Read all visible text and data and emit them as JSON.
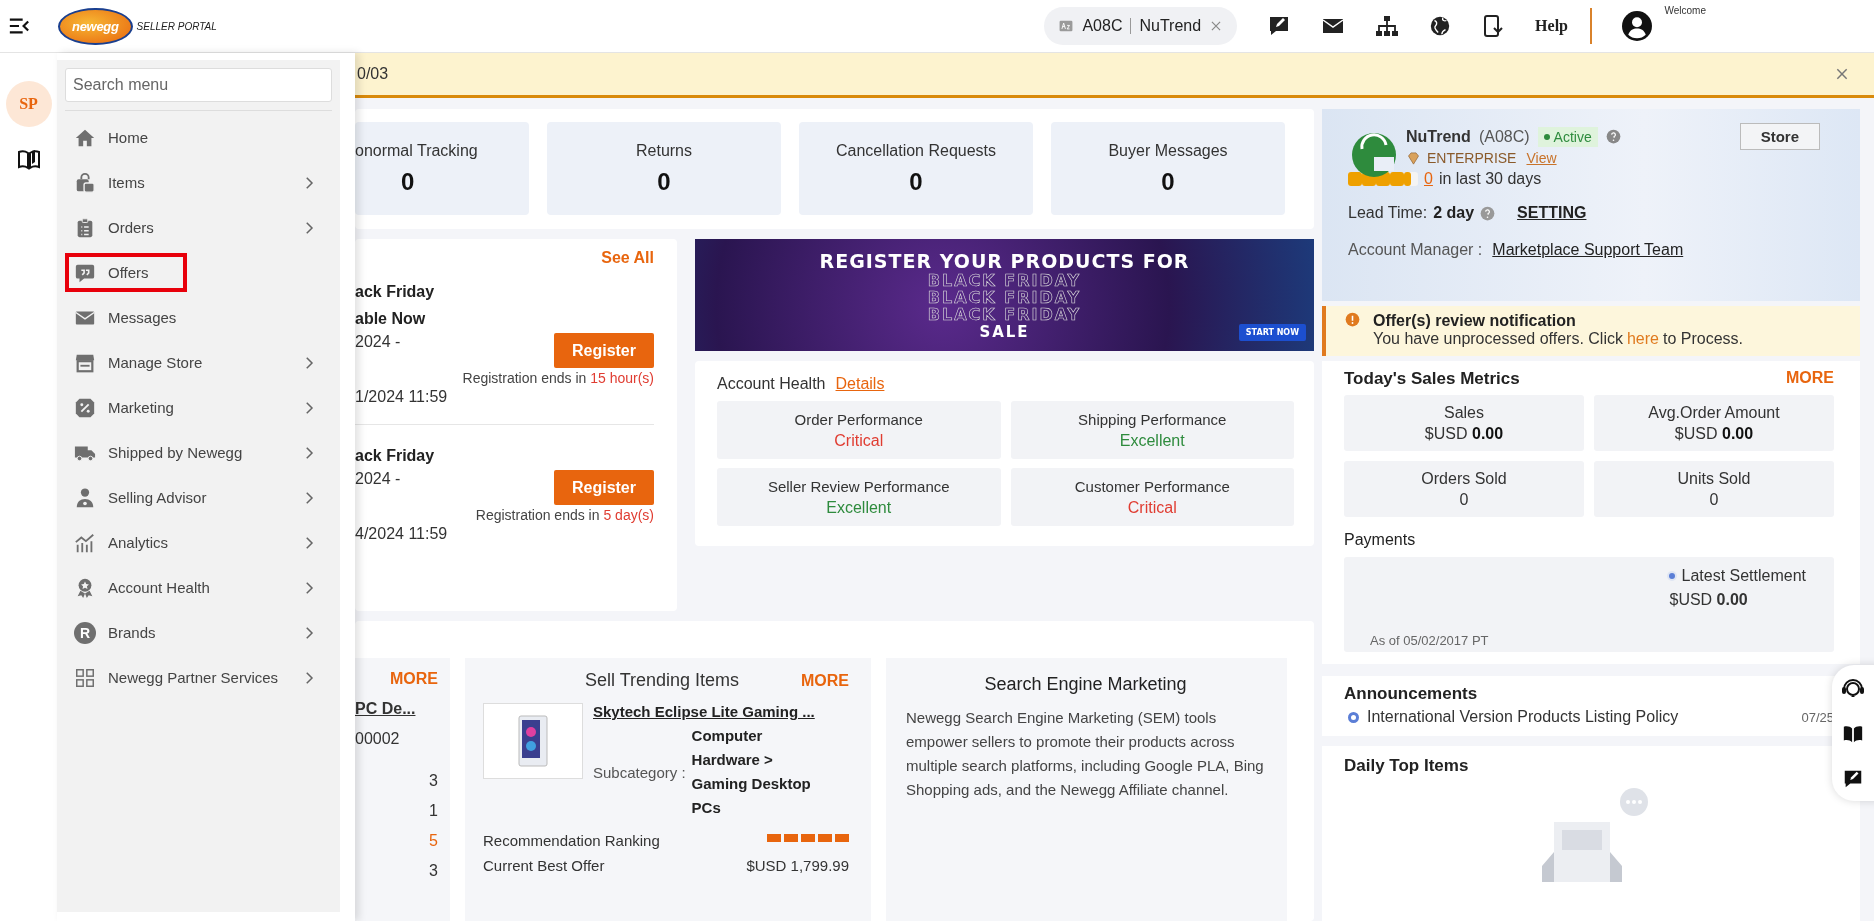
{
  "top_bar": {
    "logo_text": "newegg",
    "portal_label": "SELLER PORTAL",
    "seller_chip": {
      "code": "A08C",
      "name": "NuTrend"
    },
    "help": "Help",
    "welcome": "Welcome"
  },
  "rail": {
    "badge": "SP"
  },
  "menu": {
    "search_placeholder": "Search menu",
    "items": [
      {
        "label": "Home",
        "has_submenu": false,
        "highlighted": false
      },
      {
        "label": "Items",
        "has_submenu": true,
        "highlighted": false
      },
      {
        "label": "Orders",
        "has_submenu": true,
        "highlighted": false
      },
      {
        "label": "Offers",
        "has_submenu": false,
        "highlighted": true
      },
      {
        "label": "Messages",
        "has_submenu": false,
        "highlighted": false
      },
      {
        "label": "Manage Store",
        "has_submenu": true,
        "highlighted": false
      },
      {
        "label": "Marketing",
        "has_submenu": true,
        "highlighted": false
      },
      {
        "label": "Shipped by Newegg",
        "has_submenu": true,
        "highlighted": false
      },
      {
        "label": "Selling Advisor",
        "has_submenu": true,
        "highlighted": false
      },
      {
        "label": "Analytics",
        "has_submenu": true,
        "highlighted": false
      },
      {
        "label": "Account Health",
        "has_submenu": true,
        "highlighted": false
      },
      {
        "label": "Brands",
        "icon_text": "R",
        "has_submenu": true,
        "highlighted": false
      },
      {
        "label": "Newegg Partner Services",
        "has_submenu": true,
        "highlighted": false
      }
    ]
  },
  "notice_bar": {
    "text": "0/03"
  },
  "summary_cards": [
    {
      "label": "onormal Tracking",
      "value": "0"
    },
    {
      "label": "Returns",
      "value": "0"
    },
    {
      "label": "Cancellation Requests",
      "value": "0"
    },
    {
      "label": "Buyer Messages",
      "value": "0"
    }
  ],
  "events": {
    "see_all": "See All",
    "entries": [
      {
        "title_lines": [
          "ack Friday",
          "able Now"
        ],
        "start": "2024 -",
        "end": "1/2024 11:59",
        "button": "Register",
        "ends_prefix": "Registration ends in",
        "ends_value": "15 hour(s)"
      },
      {
        "title_lines": [
          "ack Friday"
        ],
        "start": "2024 -",
        "end": "4/2024 11:59",
        "button": "Register",
        "ends_prefix": "Registration ends in",
        "ends_value": "5 day(s)"
      }
    ]
  },
  "promo_banner": {
    "headline": "REGISTER YOUR PRODUCTS FOR",
    "repeat_lines": [
      "BLACK FRIDAY",
      "BLACK FRIDAY",
      "BLACK FRIDAY"
    ],
    "sale": "SALE",
    "cta": "START NOW"
  },
  "account_health": {
    "title": "Account Health",
    "details_link": "Details",
    "tiles": [
      {
        "label": "Order Performance",
        "status": "Critical",
        "color": "#e03c31"
      },
      {
        "label": "Shipping Performance",
        "status": "Excellent",
        "color": "#2e8b3d"
      },
      {
        "label": "Seller Review Performance",
        "status": "Excellent",
        "color": "#2e8b3d"
      },
      {
        "label": "Customer Performance",
        "status": "Critical",
        "color": "#e03c31"
      }
    ]
  },
  "top_sellers": {
    "more": "MORE",
    "item_name": "PC De...",
    "item_number": "00002",
    "counts": [
      {
        "value": "3",
        "color": "#333333"
      },
      {
        "value": "1",
        "color": "#333333"
      },
      {
        "value": "5",
        "color": "#e8650e"
      },
      {
        "value": "3",
        "color": "#333333"
      }
    ]
  },
  "sell_trending": {
    "title": "Sell Trending Items",
    "more": "MORE",
    "product_name": "Skytech Eclipse Lite Gaming ...",
    "subcategory_label": "Subcategory :",
    "subcategory": "Computer Hardware > Gaming Desktop PCs",
    "ranking_label": "Recommendation Ranking",
    "stars": 5,
    "offer_label": "Current Best Offer",
    "offer_value": "$USD 1,799.99"
  },
  "sem": {
    "title": "Search Engine Marketing",
    "text": "Newegg Search Engine Marketing (SEM) tools empower sellers to promote their products across multiple search platforms, including Google PLA, Bing Shopping ads, and the Newegg Affiliate channel."
  },
  "store": {
    "name": "NuTrend",
    "code": "(A08C)",
    "status": "Active",
    "store_button": "Store",
    "tier": "ENTERPRISE",
    "view_link": "View",
    "stars": 4.5,
    "review_count": "0",
    "review_period": "in last 30 days",
    "lead_label": "Lead Time:",
    "lead_value": "2 day",
    "setting_link": "SETTING",
    "manager_label": "Account Manager :",
    "manager_link": "Marketplace Support Team"
  },
  "offer_notification": {
    "title": "Offer(s) review notification",
    "text_before": "You have unprocessed offers. Click",
    "link": "here",
    "text_after": "to Process."
  },
  "sales_metrics": {
    "title": "Today's Sales Metrics",
    "more": "MORE",
    "tiles": [
      {
        "label": "Sales",
        "prefix": "$USD",
        "value": "0.00"
      },
      {
        "label": "Avg.Order Amount",
        "prefix": "$USD",
        "value": "0.00"
      },
      {
        "label": "Orders Sold",
        "value": "0"
      },
      {
        "label": "Units Sold",
        "value": "0"
      }
    ]
  },
  "payments": {
    "title": "Payments",
    "settlement_label": "Latest Settlement",
    "prefix": "$USD",
    "value": "0.00",
    "as_of": "As of 05/02/2017 PT"
  },
  "announcements": {
    "title": "Announcements",
    "items": [
      {
        "text": "International Version Products Listing Policy",
        "date": "07/25"
      }
    ]
  },
  "daily_top_items": {
    "title": "Daily Top Items"
  }
}
